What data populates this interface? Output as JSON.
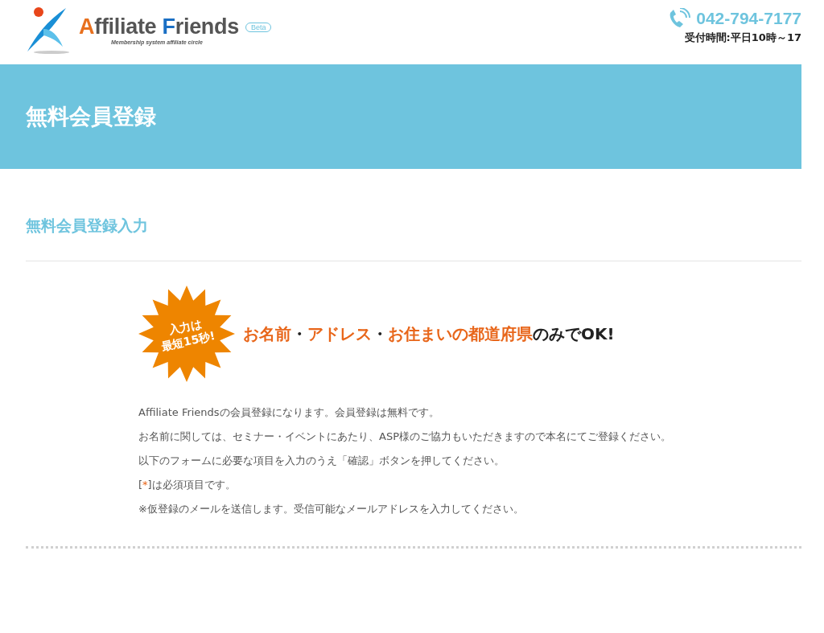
{
  "header": {
    "logo": {
      "parts": [
        {
          "text": "A",
          "color": "#e8701e"
        },
        {
          "text": "ffiliate ",
          "color": "#555555"
        },
        {
          "text": "F",
          "color": "#1a6fc4"
        },
        {
          "text": "riends",
          "color": "#555555"
        }
      ],
      "badge": "Beta",
      "tagline": "Membership system affiliate circle"
    },
    "phone": "042-794-7177",
    "hours": "受付時間:平日10時～17"
  },
  "banner": {
    "title": "無料会員登録"
  },
  "section": {
    "title": "無料会員登録入力"
  },
  "promo": {
    "burst": [
      "入力は",
      "最短15秒!"
    ],
    "headline": [
      {
        "text": "お名前",
        "accent": true
      },
      {
        "text": "・",
        "accent": false
      },
      {
        "text": "アドレス",
        "accent": true
      },
      {
        "text": "・",
        "accent": false
      },
      {
        "text": "お住まいの都道府県",
        "accent": true
      },
      {
        "text": "のみでOK!",
        "accent": false
      }
    ]
  },
  "notes": [
    [
      {
        "text": "Affiliate Friendsの会員登録になります。会員登録は無料です。",
        "accent": false
      }
    ],
    [
      {
        "text": "お名前に関しては、セミナー・イベントにあたり、ASP様のご協力もいただきますので本名にてご登録ください。",
        "accent": false
      }
    ],
    [
      {
        "text": "以下のフォームに必要な項目を入力のうえ「確認」ボタンを押してください。",
        "accent": false
      }
    ],
    [
      {
        "text": "[",
        "accent": false
      },
      {
        "text": "*",
        "accent": true
      },
      {
        "text": "]は必須項目です。",
        "accent": false
      }
    ],
    [
      {
        "text": "※仮登録のメールを送信します。受信可能なメールアドレスを入力してください。",
        "accent": false
      }
    ]
  ]
}
